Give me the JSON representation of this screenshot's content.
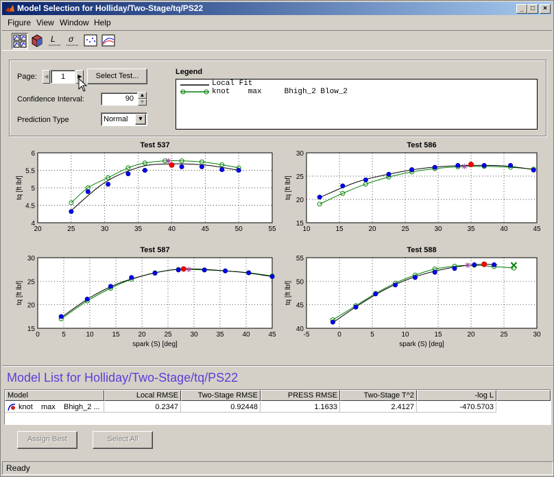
{
  "window": {
    "title": "Model Selection for Holliday/Two-Stage/tq/PS22"
  },
  "menu": [
    "Figure",
    "View",
    "Window",
    "Help"
  ],
  "toolbar": {
    "tools": [
      "response-view-icon",
      "cube-icon",
      "likelihood-icon",
      "rmse-icon",
      "residuals-icon",
      "cross-section-icon"
    ]
  },
  "controls": {
    "page_label": "Page:",
    "page_value": "1",
    "select_test": "Select Test...",
    "ci_label": "Confidence Interval:",
    "ci_value": "90",
    "prediction_label": "Prediction Type",
    "prediction_value": "Normal"
  },
  "legend": {
    "title": "Legend",
    "line1": "Local Fit",
    "line2": "knot    max     Bhigh_2 Blow_2",
    "local_color": "#000000",
    "model_color": "#008000"
  },
  "chart_data": [
    {
      "type": "scatter",
      "title": "Test 537",
      "xlabel": "",
      "ylabel": "tq [ft lbf]",
      "xlim": [
        20,
        55
      ],
      "ylim": [
        4,
        6
      ],
      "xticks": [
        20,
        25,
        30,
        35,
        40,
        45,
        50,
        55
      ],
      "yticks": [
        4,
        4.5,
        5,
        5.5,
        6
      ],
      "data": {
        "x": [
          25,
          27.5,
          30.5,
          33.5,
          36,
          41.5,
          44.5,
          47.5,
          50
        ],
        "y": [
          4.32,
          4.89,
          5.1,
          5.4,
          5.5,
          5.6,
          5.6,
          5.52,
          5.5
        ]
      },
      "local_fit": {
        "x": [
          25,
          30,
          35,
          39,
          45,
          50
        ],
        "y": [
          4.35,
          5.15,
          5.58,
          5.68,
          5.65,
          5.5
        ]
      },
      "model_fit": {
        "x": [
          25,
          27.5,
          30.5,
          33.5,
          36,
          39,
          41.5,
          44.5,
          47.5,
          50
        ],
        "y": [
          4.57,
          5.0,
          5.29,
          5.57,
          5.71,
          5.77,
          5.77,
          5.74,
          5.66,
          5.57
        ]
      },
      "knot_local": {
        "x": 40,
        "y": 5.65
      },
      "knot_model": {
        "x": 39.5,
        "y": 5.77
      }
    },
    {
      "type": "scatter",
      "title": "Test 586",
      "xlabel": "",
      "ylabel": "tq [ft lbf]",
      "xlim": [
        10,
        45
      ],
      "ylim": [
        15,
        30
      ],
      "xticks": [
        10,
        15,
        20,
        25,
        30,
        35,
        40,
        45
      ],
      "yticks": [
        15,
        20,
        25,
        30
      ],
      "data": {
        "x": [
          12,
          15.5,
          19,
          22.5,
          26,
          29.5,
          33,
          37,
          41,
          44.5
        ],
        "y": [
          20.5,
          22.9,
          24.2,
          25.4,
          26.4,
          26.9,
          27.3,
          27.3,
          27.3,
          26.3
        ]
      },
      "local_fit": {
        "x": [
          12,
          18,
          25,
          30,
          35,
          40,
          44.5
        ],
        "y": [
          20.4,
          23.9,
          26.1,
          27.0,
          27.3,
          27.2,
          26.4
        ]
      },
      "model_fit": {
        "x": [
          12,
          15.5,
          19,
          22.5,
          26,
          29.5,
          33,
          37,
          41,
          44.5
        ],
        "y": [
          19.0,
          21.3,
          23.3,
          24.8,
          25.9,
          26.6,
          27.0,
          27.1,
          26.9,
          26.5
        ]
      },
      "knot_local": {
        "x": 35,
        "y": 27.5
      },
      "knot_model": {
        "x": 34,
        "y": 27.1
      }
    },
    {
      "type": "scatter",
      "title": "Test 587",
      "xlabel": "spark (S) [deg]",
      "ylabel": "tq [ft lbf]",
      "xlim": [
        0,
        45
      ],
      "ylim": [
        15,
        30
      ],
      "xticks": [
        0,
        5,
        10,
        15,
        20,
        25,
        30,
        35,
        40,
        45
      ],
      "yticks": [
        15,
        20,
        25,
        30
      ],
      "data": {
        "x": [
          4.5,
          9.5,
          14,
          18,
          22.5,
          27,
          32,
          36,
          40.5,
          45
        ],
        "y": [
          17.5,
          21.2,
          23.9,
          25.8,
          26.7,
          27.4,
          27.4,
          27.2,
          26.8,
          26.0
        ]
      },
      "local_fit": {
        "x": [
          4.5,
          10,
          15,
          20,
          25,
          28,
          32,
          36,
          40,
          45
        ],
        "y": [
          17.3,
          21.5,
          24.3,
          26.1,
          27.3,
          27.6,
          27.5,
          27.2,
          26.8,
          26.0
        ]
      },
      "model_fit": {
        "x": [
          4.5,
          9.5,
          14,
          18,
          22.5,
          27,
          32,
          36,
          40.5,
          45
        ],
        "y": [
          17.0,
          20.8,
          23.5,
          25.4,
          26.8,
          27.5,
          27.4,
          27.2,
          26.8,
          26.1
        ]
      },
      "knot_local": {
        "x": 28,
        "y": 27.6
      },
      "knot_model": {
        "x": 29,
        "y": 27.5
      }
    },
    {
      "type": "scatter",
      "title": "Test 588",
      "xlabel": "spark (S) [deg]",
      "ylabel": "tq [ft lbf]",
      "xlim": [
        -5,
        30
      ],
      "ylim": [
        40,
        55
      ],
      "xticks": [
        -5,
        0,
        5,
        10,
        15,
        20,
        25,
        30
      ],
      "yticks": [
        40,
        45,
        50,
        55
      ],
      "data": {
        "x": [
          -1,
          2.5,
          5.5,
          8.5,
          11.5,
          14.5,
          17.5,
          20.5,
          23.5
        ],
        "y": [
          41.3,
          44.5,
          47.3,
          49.2,
          50.8,
          51.9,
          52.7,
          53.5,
          53.5
        ]
      },
      "local_fit": {
        "x": [
          -1,
          3,
          7,
          11,
          15,
          19,
          22,
          24
        ],
        "y": [
          41.2,
          45.0,
          48.3,
          50.7,
          52.3,
          53.3,
          53.6,
          53.5
        ]
      },
      "model_fit": {
        "x": [
          -1,
          2.5,
          5.5,
          8.5,
          11.5,
          14.5,
          17.5,
          20.5,
          23.5,
          26.5
        ],
        "y": [
          41.8,
          44.8,
          47.4,
          49.6,
          51.3,
          52.6,
          53.2,
          53.4,
          53.1,
          52.8
        ]
      },
      "knot_local": {
        "x": 22,
        "y": 53.6
      },
      "knot_model": {
        "x": 19.5,
        "y": 53.4
      },
      "cross": {
        "x": 26.5,
        "y": 53.4
      }
    }
  ],
  "model_list": {
    "title": "Model List for Holliday/Two-Stage/tq/PS22",
    "columns": [
      "Model",
      "Local RMSE",
      "Two-Stage RMSE",
      "PRESS RMSE",
      "Two-Stage T^2",
      "-log L"
    ],
    "rows": [
      {
        "model": "knot    max    Bhigh_2 ...",
        "local_rmse": "0.2347",
        "two_stage_rmse": "0.92448",
        "press_rmse": "1.1633",
        "t2": "2.4127",
        "logl": "-470.5703"
      }
    ]
  },
  "buttons": {
    "assign_best": "Assign Best",
    "select_all": "Select All"
  },
  "status": "Ready"
}
